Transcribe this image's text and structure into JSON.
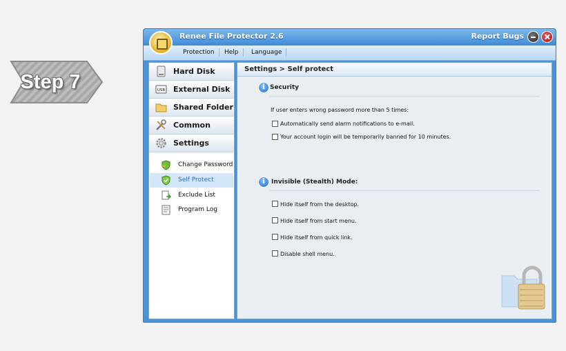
{
  "step_badge": {
    "label": "Step 7"
  },
  "window": {
    "title": "Renee File Protector 2.6",
    "report_bugs": "Report Bugs",
    "menu": [
      "Protection",
      "Help",
      "Language"
    ]
  },
  "sidebar": {
    "nav": [
      {
        "label": "Hard Disk",
        "icon": "hard-disk-icon"
      },
      {
        "label": "External Disk",
        "icon": "usb-icon"
      },
      {
        "label": "Shared Folder",
        "icon": "folder-icon"
      },
      {
        "label": "Common",
        "icon": "tools-icon"
      },
      {
        "label": "Settings",
        "icon": "gear-icon"
      }
    ],
    "sub": [
      {
        "label": "Change Password",
        "icon": "key-shield-icon"
      },
      {
        "label": "Self Protect",
        "icon": "shield-icon",
        "active": true
      },
      {
        "label": "Exclude List",
        "icon": "exclude-list-icon"
      },
      {
        "label": "Program Log",
        "icon": "log-icon"
      }
    ]
  },
  "main": {
    "breadcrumb": "Settings > Self protect",
    "security": {
      "title": "Security",
      "intro": "If user enters wrong password more than 5 times:",
      "options": [
        "Automatically send alarm notifications to e-mail.",
        "Your account login will be temporarily banned for 10 minutes."
      ]
    },
    "stealth": {
      "title": "Invisible (Stealth) Mode:",
      "options": [
        "Hide itself from the desktop.",
        "Hide itself from start menu.",
        "Hide itself from quick link.",
        "Disable shell menu."
      ]
    }
  }
}
